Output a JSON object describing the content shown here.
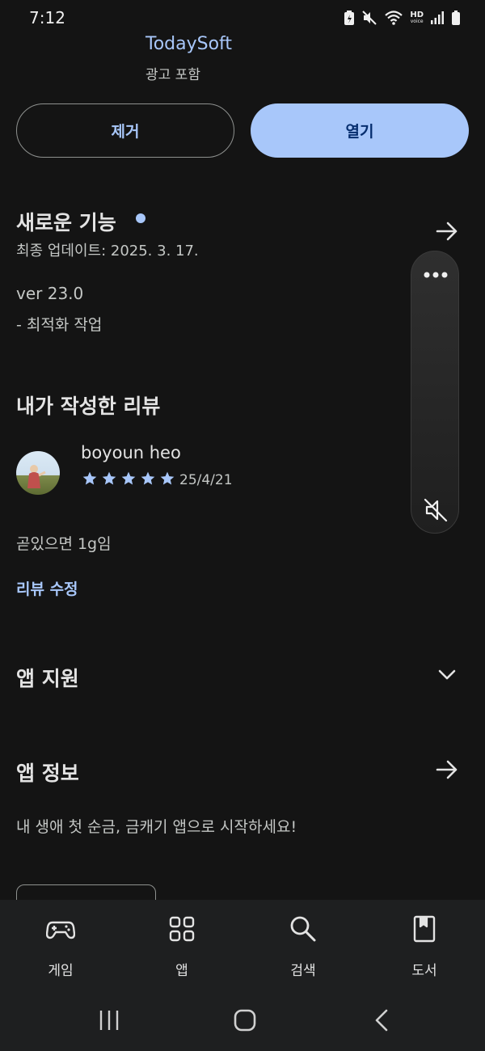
{
  "status_bar": {
    "time": "7:12",
    "hd_label": "HD",
    "voice_label": "voice"
  },
  "app": {
    "developer": "TodaySoft",
    "ads_note": "광고 포함"
  },
  "actions": {
    "remove_label": "제거",
    "open_label": "열기"
  },
  "whats_new": {
    "title": "새로운 기능",
    "last_updated": "최종 업데이트: 2025. 3. 17.",
    "version": "ver 23.0",
    "note": "- 최적화 작업"
  },
  "my_review": {
    "title": "내가 작성한 리뷰",
    "reviewer": "boyoun heo",
    "rating": 5,
    "date": "25/4/21",
    "text": "곧있으면 1g임",
    "edit_label": "리뷰 수정"
  },
  "app_support": {
    "title": "앱 지원"
  },
  "app_info": {
    "title": "앱 정보",
    "description": "내 생애 첫 순금, 금캐기 앱으로 시작하세요!"
  },
  "bottom_nav": {
    "items": [
      {
        "label": "게임",
        "icon": "gamepad-icon"
      },
      {
        "label": "앱",
        "icon": "apps-grid-icon"
      },
      {
        "label": "검색",
        "icon": "search-icon"
      },
      {
        "label": "도서",
        "icon": "book-icon"
      }
    ]
  },
  "colors": {
    "accent": "#a8c7fa",
    "background": "#141414",
    "nav_background": "#1e1f20"
  }
}
